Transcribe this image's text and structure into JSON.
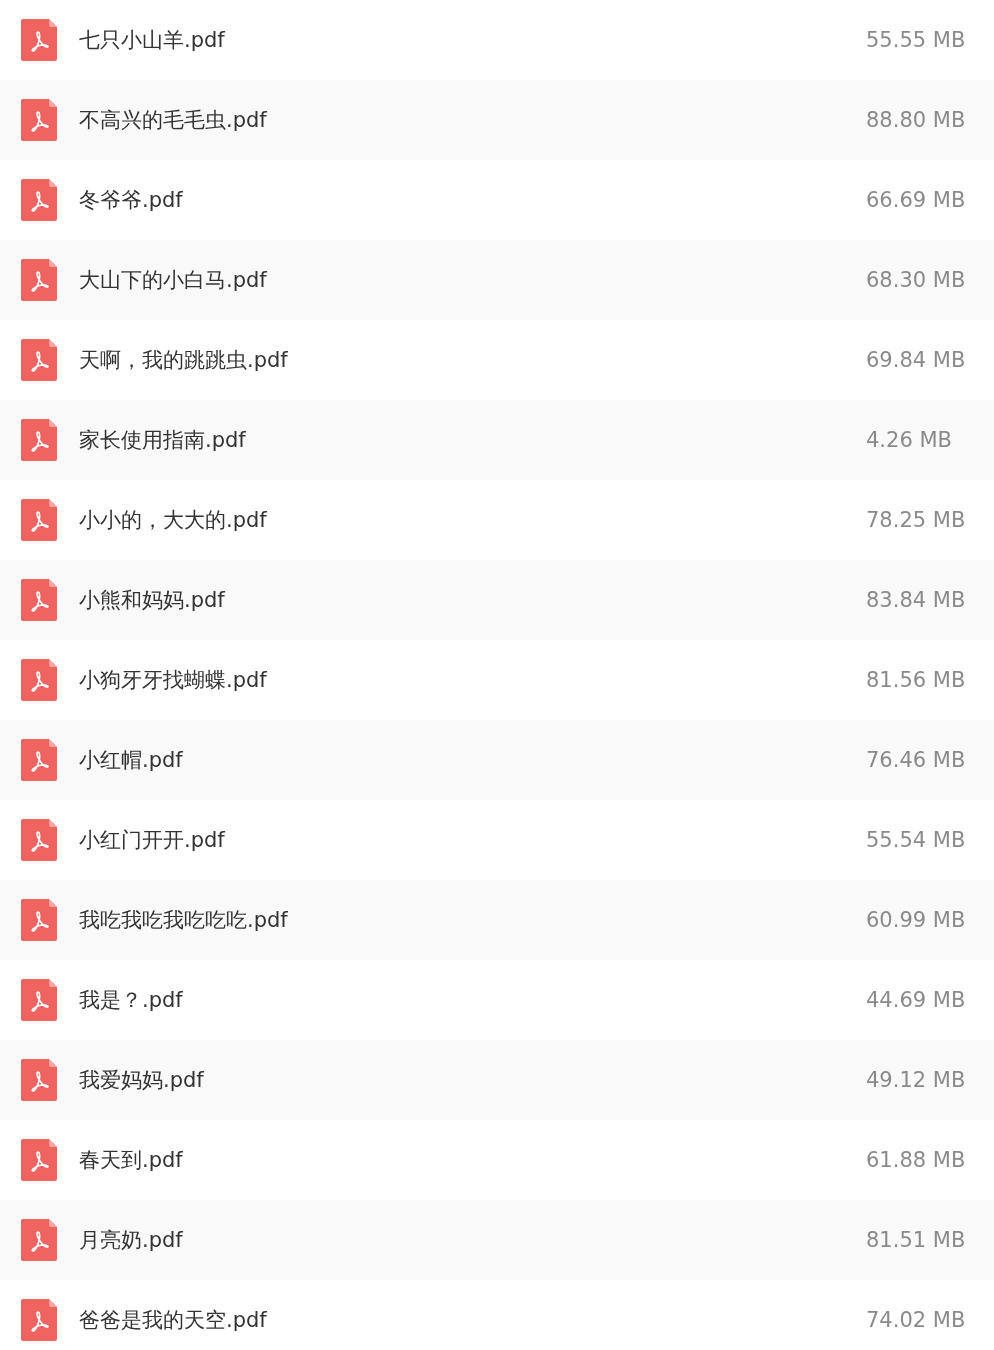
{
  "files": [
    {
      "name": "七只小山羊.pdf",
      "size": "55.55 MB"
    },
    {
      "name": "不高兴的毛毛虫.pdf",
      "size": "88.80 MB"
    },
    {
      "name": "冬爷爷.pdf",
      "size": "66.69 MB"
    },
    {
      "name": "大山下的小白马.pdf",
      "size": "68.30 MB"
    },
    {
      "name": "天啊，我的跳跳虫.pdf",
      "size": "69.84 MB"
    },
    {
      "name": "家长使用指南.pdf",
      "size": "4.26 MB"
    },
    {
      "name": "小小的，大大的.pdf",
      "size": "78.25 MB"
    },
    {
      "name": "小熊和妈妈.pdf",
      "size": "83.84 MB"
    },
    {
      "name": "小狗牙牙找蝴蝶.pdf",
      "size": "81.56 MB"
    },
    {
      "name": "小红帽.pdf",
      "size": "76.46 MB"
    },
    {
      "name": "小红门开开.pdf",
      "size": "55.54 MB"
    },
    {
      "name": "我吃我吃我吃吃吃.pdf",
      "size": "60.99 MB"
    },
    {
      "name": "我是？.pdf",
      "size": "44.69 MB"
    },
    {
      "name": "我爱妈妈.pdf",
      "size": "49.12 MB"
    },
    {
      "name": "春天到.pdf",
      "size": "61.88 MB"
    },
    {
      "name": "月亮奶.pdf",
      "size": "81.51 MB"
    },
    {
      "name": "爸爸是我的天空.pdf",
      "size": "74.02 MB"
    }
  ]
}
